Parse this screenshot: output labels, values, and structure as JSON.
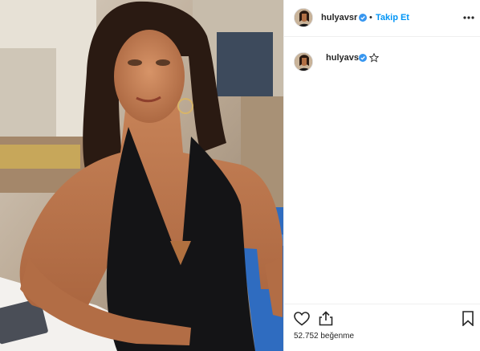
{
  "post": {
    "author": {
      "username": "hulyavsr",
      "verified": true
    },
    "header": {
      "separator": "•",
      "follow_label": "Takip Et"
    },
    "comment_owner": {
      "username": "hulyavsr"
    },
    "likes": {
      "count_text": "52.752 beğenme"
    },
    "icons": {
      "more": "more-horizontal-icon",
      "verified": "verified-badge-icon",
      "star": "star-outline-icon",
      "like": "heart-outline-icon",
      "share": "share-icon",
      "save": "bookmark-outline-icon"
    },
    "colors": {
      "accent": "#0095f6",
      "text": "#262626",
      "divider": "#efefef"
    }
  }
}
